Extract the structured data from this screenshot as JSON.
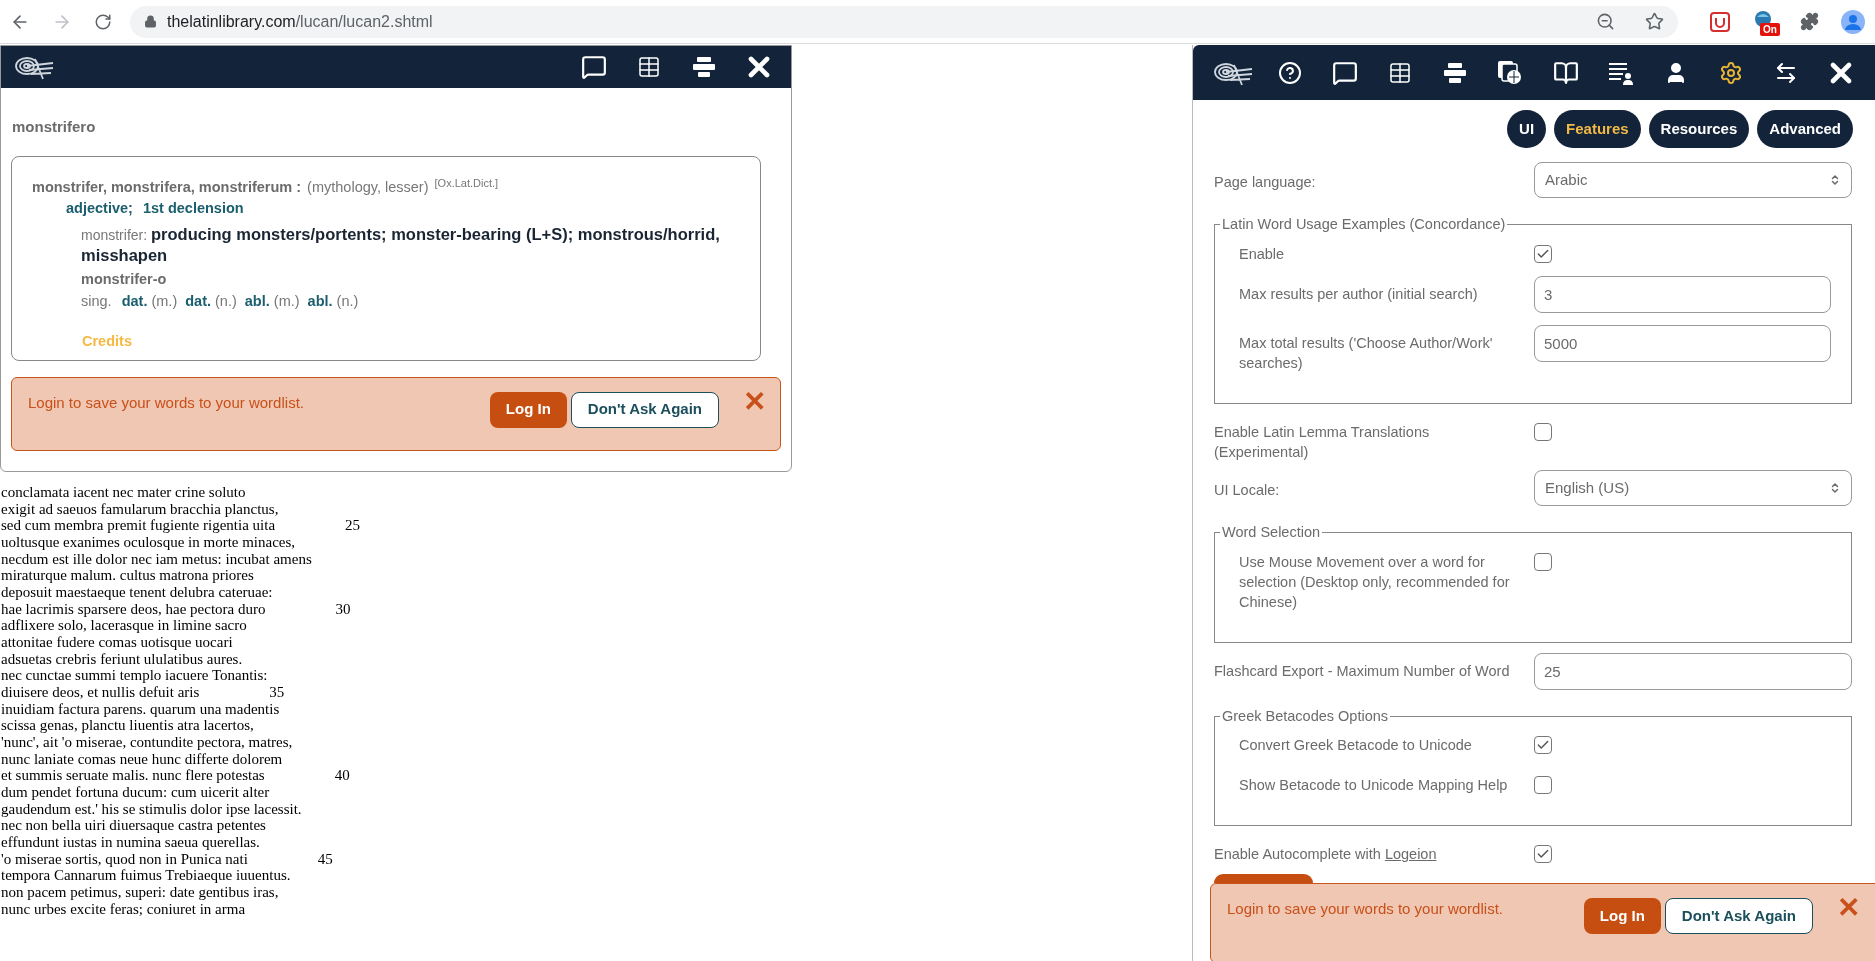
{
  "browser": {
    "url_host": "thelatinlibrary.com",
    "url_path": "/lucan/lucan2.shtml",
    "extension_badge": "On"
  },
  "poem": [
    {
      "text": "conclamata iacent nec mater crine soluto"
    },
    {
      "text": "exigit ad saeuos famularum bracchia planctus,"
    },
    {
      "text": "sed cum membra premit fugiente rigentia uita",
      "number": "25"
    },
    {
      "text": "uoltusque exanimes oculosque in morte minaces,"
    },
    {
      "text": "necdum est ille dolor nec iam metus: incubat amens"
    },
    {
      "text": "miraturque malum. cultus matrona priores"
    },
    {
      "text": "deposuit maestaeque tenent delubra cateruae:"
    },
    {
      "text": "hae lacrimis sparsere deos, hae pectora duro",
      "number": "30"
    },
    {
      "text": "adflixere solo, lacerasque in limine sacro"
    },
    {
      "text": "attonitae fudere comas uotisque uocari"
    },
    {
      "text": "adsuetas crebris feriunt ululatibus aures."
    },
    {
      "text": "nec cunctae summi templo iacuere Tonantis:"
    },
    {
      "text": "diuisere deos, et nullis defuit aris",
      "number": "35"
    },
    {
      "text": "inuidiam factura parens. quarum una madentis"
    },
    {
      "text": "scissa genas, planctu liuentis atra lacertos,"
    },
    {
      "text": "'nunc', ait 'o miserae, contundite pectora, matres,"
    },
    {
      "text": "nunc laniate comas neue hunc differte dolorem"
    },
    {
      "text": "et summis seruate malis. nunc flere potestas",
      "number": "40"
    },
    {
      "text": "dum pendet fortuna ducum: cum uicerit alter"
    },
    {
      "text": "gaudendum est.' his se stimulis dolor ipse lacessit."
    },
    {
      "text": "nec non bella uiri diuersaque castra petentes"
    },
    {
      "text": "effundunt iustas in numina saeua querellas."
    },
    {
      "text": "'o miserae sortis, quod non in Punica nati",
      "number": "45"
    },
    {
      "text": "tempora Cannarum fuimus Trebiaeque iuuentus."
    },
    {
      "text": "non pacem petimus, superi: date gentibus iras,"
    },
    {
      "text": "nunc urbes excite feras; coniuret in arma"
    }
  ],
  "lookup_popup": {
    "toolbar": [
      {
        "kind": "logo"
      },
      {
        "kind": "comment"
      },
      {
        "kind": "table"
      },
      {
        "kind": "form"
      },
      {
        "kind": "close"
      }
    ],
    "word": "monstrifero",
    "entry": {
      "headword": "monstrifer, monstrifera, monstriferum :",
      "tags": "(mythology, lesser)",
      "source": "[Ox.Lat.Dict.]",
      "grammar": [
        "adjective;",
        "1st declension"
      ],
      "stem": "monstrifer:",
      "definition": "producing monsters/portents; monster-bearing (L+S); monstrous/horrid, misshapen",
      "form": "monstrifer-o",
      "number": "sing.",
      "inflections": [
        {
          "case": "dat.",
          "gender": "(m.)"
        },
        {
          "case": "dat.",
          "gender": "(n.)"
        },
        {
          "case": "abl.",
          "gender": "(m.)"
        },
        {
          "case": "abl.",
          "gender": "(n.)"
        }
      ],
      "credits": "Credits"
    },
    "login_banner": {
      "message": "Login to save your words to your wordlist.",
      "login": "Log In",
      "dismiss": "Don't Ask Again",
      "close": "✕"
    }
  },
  "settings_panel": {
    "toolbar": [
      {
        "kind": "logo",
        "selected": false
      },
      {
        "kind": "help",
        "selected": false
      },
      {
        "kind": "comment",
        "selected": false
      },
      {
        "kind": "table",
        "selected": false
      },
      {
        "kind": "form",
        "selected": false
      },
      {
        "kind": "files",
        "selected": false
      },
      {
        "kind": "book",
        "selected": false
      },
      {
        "kind": "list",
        "selected": false
      },
      {
        "kind": "user",
        "selected": false
      },
      {
        "kind": "settings",
        "selected": true
      },
      {
        "kind": "swap",
        "selected": false
      },
      {
        "kind": "close",
        "selected": false
      }
    ],
    "tabs": [
      {
        "label": "UI",
        "selected": false
      },
      {
        "label": "Features",
        "selected": true
      },
      {
        "label": "Resources",
        "selected": false
      },
      {
        "label": "Advanced",
        "selected": false
      }
    ],
    "rows": [
      {
        "kind": "select",
        "label": "Page language:",
        "value": "Arabic"
      },
      {
        "kind": "group",
        "legend": "Latin Word Usage Examples (Concordance)",
        "rows": [
          {
            "kind": "checkbox",
            "label": "Enable",
            "checked": true
          },
          {
            "kind": "input",
            "label": "Max results per author (initial search)",
            "value": "3"
          },
          {
            "kind": "input",
            "label": "Max total results ('Choose Author/Work' searches)",
            "value": "5000"
          }
        ]
      },
      {
        "kind": "checkbox",
        "label": "Enable Latin Lemma Translations (Experimental)",
        "checked": false
      },
      {
        "kind": "select",
        "label": "UI Locale:",
        "value": "English (US)"
      },
      {
        "kind": "group",
        "legend": "Word Selection",
        "rows": [
          {
            "kind": "checkbox",
            "label": "Use Mouse Movement over a word for selection (Desktop only, recommended for Chinese)",
            "checked": false
          }
        ]
      },
      {
        "kind": "input",
        "label": "Flashcard Export - Maximum Number of Word",
        "value": "25"
      },
      {
        "kind": "group",
        "legend": "Greek Betacodes Options",
        "rows": [
          {
            "kind": "checkbox",
            "label": "Convert Greek Betacode to Unicode",
            "checked": true
          },
          {
            "kind": "checkbox",
            "label": "Show Betacode to Unicode Mapping Help",
            "checked": false
          }
        ]
      },
      {
        "kind": "checkbox",
        "label": "Enable Autocomplete with",
        "link": "Logeion",
        "checked": true
      }
    ],
    "login_banner": {
      "message": "Login to save your words to your wordlist.",
      "login": "Log In",
      "dismiss": "Don't Ask Again",
      "close": "✕"
    }
  }
}
